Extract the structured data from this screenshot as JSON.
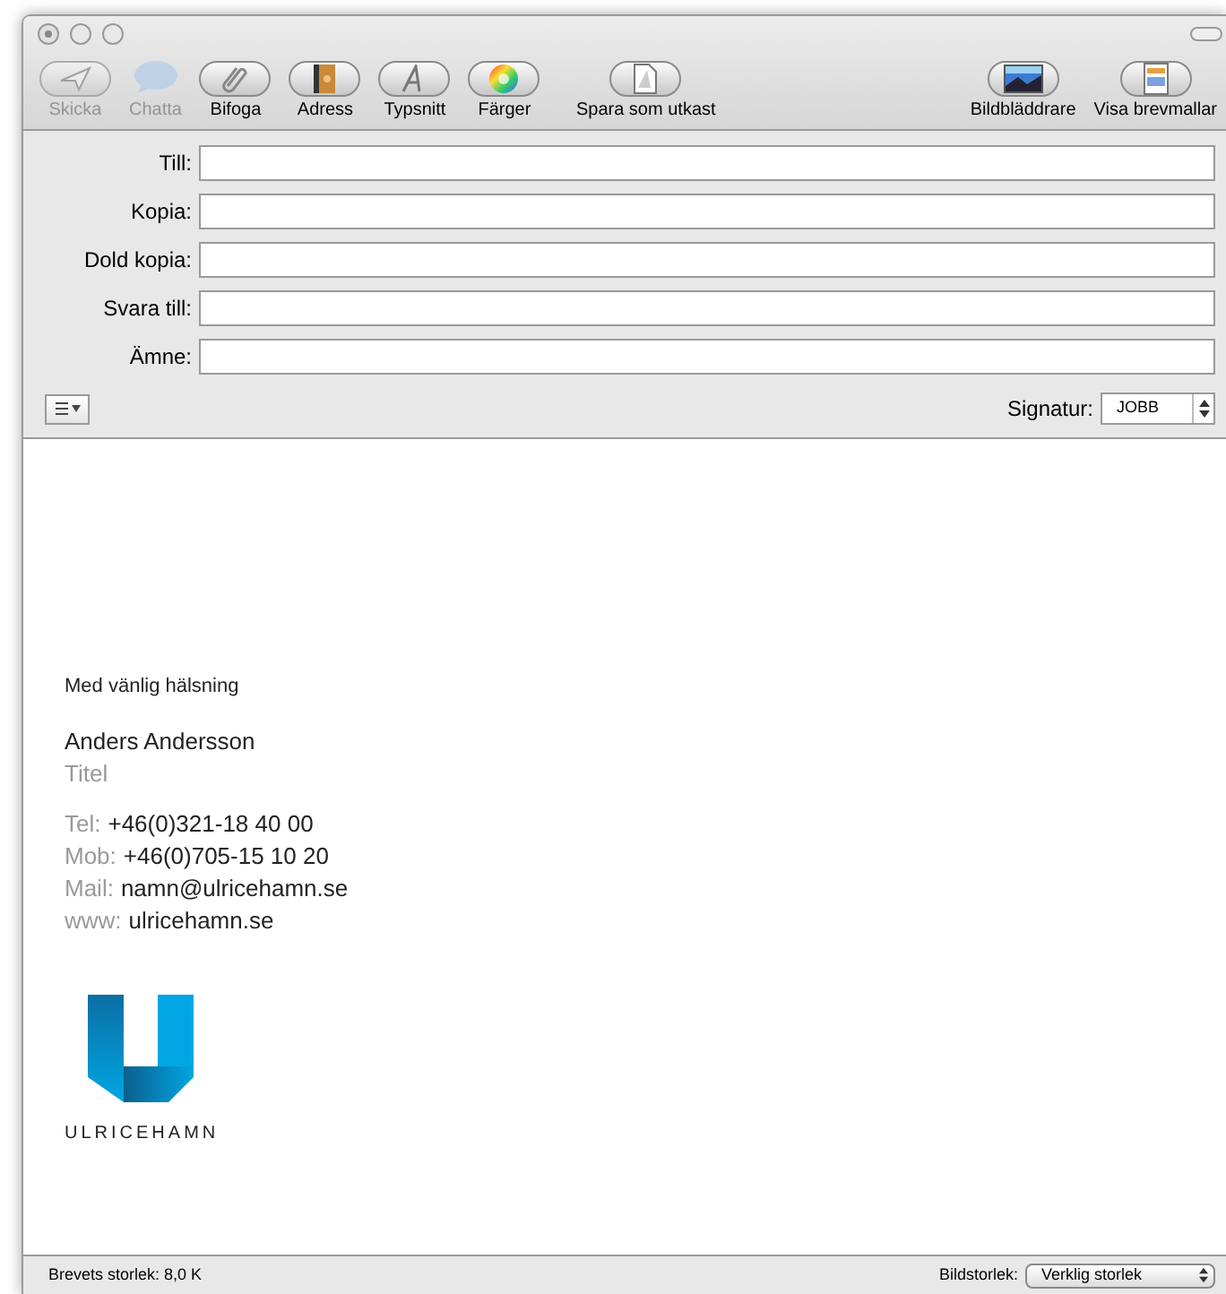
{
  "toolbar": [
    {
      "kind": "send",
      "label": "Skicka",
      "disabled": true
    },
    {
      "kind": "chat",
      "label": "Chatta",
      "disabled": true
    },
    {
      "kind": "attach",
      "label": "Bifoga",
      "disabled": false
    },
    {
      "kind": "address",
      "label": "Adress",
      "disabled": false
    },
    {
      "kind": "font",
      "label": "Typsnitt",
      "disabled": false
    },
    {
      "kind": "colors",
      "label": "Färger",
      "disabled": false
    },
    {
      "kind": "draft",
      "label": "Spara som utkast",
      "disabled": false
    }
  ],
  "toolbar_right": [
    {
      "kind": "photo",
      "label": "Bildbläddrare",
      "disabled": false
    },
    {
      "kind": "template",
      "label": "Visa brevmallar",
      "disabled": false
    }
  ],
  "header_fields": [
    {
      "label": "Till:"
    },
    {
      "label": "Kopia:"
    },
    {
      "label": "Dold kopia:"
    },
    {
      "label": "Svara till:"
    },
    {
      "label": "Ämne:"
    }
  ],
  "signature_select": {
    "label": "Signatur:",
    "value": "JOBB"
  },
  "body": {
    "greeting": "Med vänlig hälsning",
    "name": "Anders Andersson",
    "title": "Titel",
    "contacts": [
      {
        "label": "Tel:",
        "value": "+46(0)321-18 40 00"
      },
      {
        "label": "Mob:",
        "value": "+46(0)705-15 10 20"
      },
      {
        "label": "Mail:",
        "value": "namn@ulricehamn.se"
      },
      {
        "label": "www:",
        "value": "ulricehamn.se"
      }
    ],
    "logo_text": "ULRICEHAMN"
  },
  "status_bar": {
    "size": "Brevets storlek: 8,0 K",
    "image_size_label": "Bildstorlek:",
    "image_size_value": "Verklig storlek"
  }
}
